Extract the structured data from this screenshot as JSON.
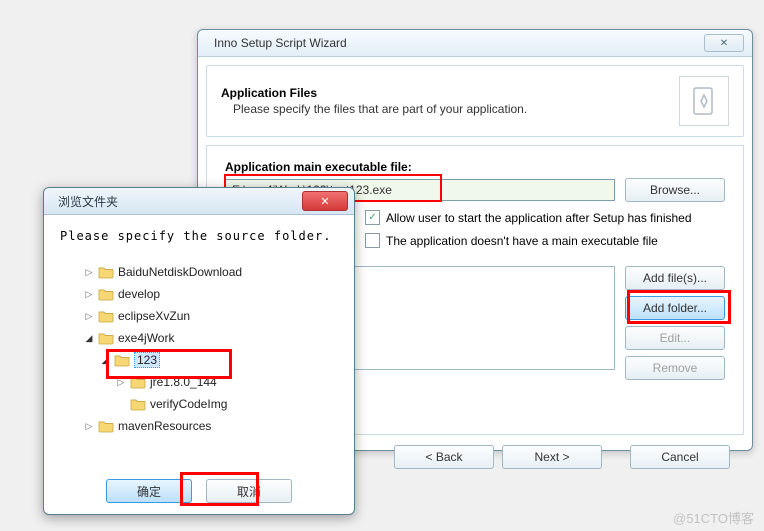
{
  "wizard": {
    "title": "Inno Setup Script Wizard",
    "header_title": "Application Files",
    "header_sub": "Please specify the files that are part of your application.",
    "exe_label": "Application main executable file:",
    "exe_value": "E:\\exe4jWork\\123\\test123.exe",
    "browse_label": "Browse...",
    "check1": "Allow user to start the application after Setup has finished",
    "check2": "The application doesn't have a main executable file",
    "addfiles_label": "Add file(s)...",
    "addfolder_label": "Add folder...",
    "edit_label": "Edit...",
    "remove_label": "Remove",
    "back_label": "< Back",
    "next_label": "Next >",
    "cancel_label": "Cancel",
    "close_label": "✕"
  },
  "browse": {
    "title": "浏览文件夹",
    "prompt": "Please specify the source folder.",
    "close_label": "✕",
    "items": [
      {
        "label": "BaiduNetdiskDownload",
        "depth": 1,
        "arrow": "closed"
      },
      {
        "label": "develop",
        "depth": 1,
        "arrow": "closed"
      },
      {
        "label": "eclipseXvZun",
        "depth": 1,
        "arrow": "closed"
      },
      {
        "label": "exe4jWork",
        "depth": 1,
        "arrow": "open"
      },
      {
        "label": "123",
        "depth": 2,
        "arrow": "open",
        "selected": true
      },
      {
        "label": "jre1.8.0_144",
        "depth": 3,
        "arrow": "closed"
      },
      {
        "label": "verifyCodeImg",
        "depth": 3,
        "arrow": "none"
      },
      {
        "label": "mavenResources",
        "depth": 1,
        "arrow": "closed"
      }
    ],
    "ok_label": "确定",
    "cancel_label": "取消"
  },
  "watermark": "@51CTO博客"
}
